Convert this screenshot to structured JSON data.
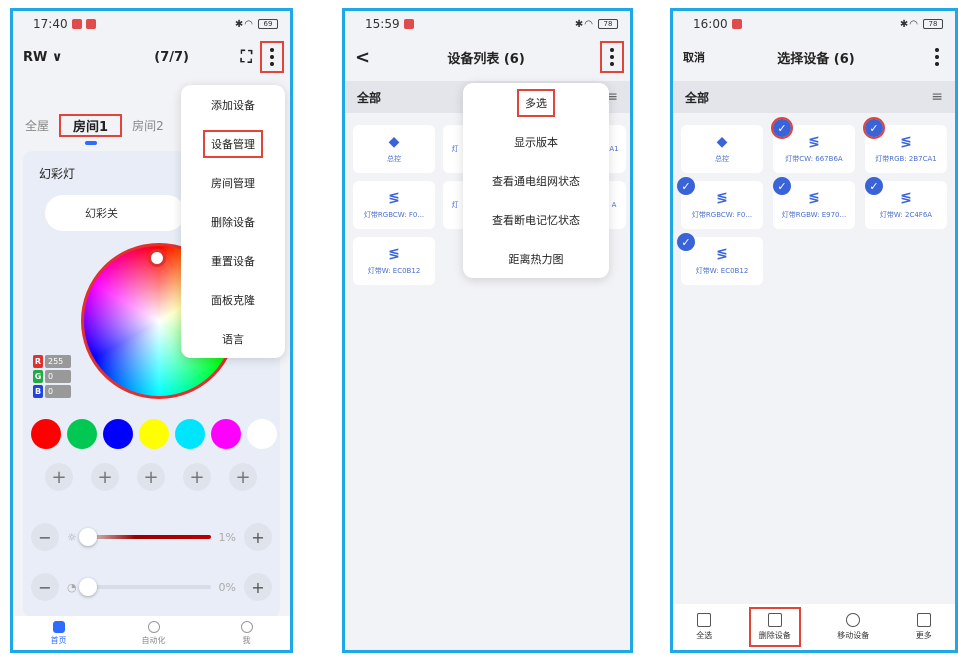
{
  "p1": {
    "status": {
      "time": "17:40",
      "battery": "69"
    },
    "header": {
      "home": "RW ∨",
      "count": "(7/7)"
    },
    "tabs": [
      "全屋",
      "房间1",
      "房间2"
    ],
    "card_title": "幻彩灯",
    "pill": "幻彩关",
    "rgb": {
      "r_label": "R",
      "r": "255",
      "g_label": "G",
      "g": "0",
      "b_label": "B",
      "b": "0"
    },
    "swatches": [
      "#ff0000",
      "#00c853",
      "#0000ff",
      "#ffff00",
      "#00e5ff",
      "#ff00ff",
      "#ffffff"
    ],
    "plus": "+",
    "brightness": {
      "value": "1%",
      "level": 0.01
    },
    "speed": {
      "value": "0%",
      "level": 0
    },
    "menu": [
      "添加设备",
      "设备管理",
      "房间管理",
      "删除设备",
      "重置设备",
      "面板克隆",
      "语言"
    ],
    "nav": [
      "首页",
      "自动化",
      "我"
    ]
  },
  "p2": {
    "status": {
      "time": "15:59",
      "battery": "78"
    },
    "title": "设备列表 (6)",
    "back": "<",
    "all": "全部",
    "tiles": [
      {
        "icon": "◆",
        "label": "总控"
      },
      {
        "icon": "≶",
        "label": "灯带RGBCW: F0..."
      },
      {
        "icon": "≶",
        "label": "灯带W: EC0B12"
      }
    ],
    "partial": [
      "灯",
      "A1",
      "灯",
      "A"
    ],
    "menu": [
      "多选",
      "显示版本",
      "查看通电组网状态",
      "查看断电记忆状态",
      "距离热力图"
    ]
  },
  "p3": {
    "status": {
      "time": "16:00",
      "battery": "78"
    },
    "cancel": "取消",
    "title": "选择设备 (6)",
    "all": "全部",
    "tiles": [
      {
        "icon": "◆",
        "label": "总控"
      },
      {
        "icon": "≶",
        "label": "灯带CW: 667B6A"
      },
      {
        "icon": "≶",
        "label": "灯带RGB: 2B7CA1"
      },
      {
        "icon": "≶",
        "label": "灯带RGBCW: F0..."
      },
      {
        "icon": "≶",
        "label": "灯带RGBW: E970..."
      },
      {
        "icon": "≶",
        "label": "灯带W: 2C4F6A"
      },
      {
        "icon": "≶",
        "label": "灯带W: EC0B12"
      }
    ],
    "check": "✓",
    "bottom": [
      "全选",
      "删除设备",
      "移动设备",
      "更多"
    ]
  }
}
